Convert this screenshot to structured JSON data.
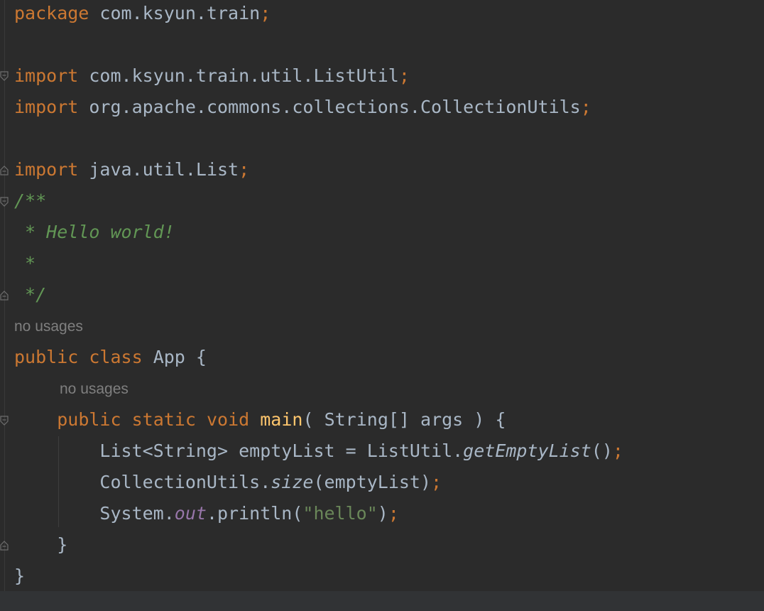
{
  "editor": {
    "language": "java",
    "colors": {
      "background": "#2b2b2b",
      "keyword": "#cc7832",
      "identifier": "#a9b7c6",
      "method_decl": "#ffc66d",
      "javadoc": "#629755",
      "string": "#6a8759",
      "static_field": "#9876aa",
      "inlay_hint": "#7f7f7f"
    },
    "code": {
      "package_kw": "package",
      "package_name": "com.ksyun.train",
      "semi": ";",
      "import_kw": "import",
      "import1": "com.ksyun.train.util.ListUtil",
      "import2": "org.apache.commons.collections.CollectionUtils",
      "import3": "java.util.List",
      "doc_open": "/**",
      "doc_line1": " * Hello world!",
      "doc_line2": " *",
      "doc_close": " */",
      "public_kw": "public",
      "class_kw": "class",
      "class_name": "App",
      "open_brace": "{",
      "close_brace": "}",
      "static_kw": "static",
      "void_kw": "void",
      "method_name": "main",
      "params": "( String[] args )",
      "stmt1_type": "List<String> emptyList = ListUtil.",
      "stmt1_call": "getEmptyList",
      "stmt1_paren": "()",
      "stmt2_type": "CollectionUtils.",
      "stmt2_call": "size",
      "stmt2_args": "(emptyList)",
      "stmt3_obj": "System.",
      "stmt3_field": "out",
      "stmt3_call": ".println(",
      "stmt3_str": "\"hello\"",
      "stmt3_close": ")"
    },
    "hints": {
      "class_usages": "no usages",
      "method_usages": "no usages"
    },
    "fold_icons": [
      "fold-marker-icon"
    ]
  }
}
